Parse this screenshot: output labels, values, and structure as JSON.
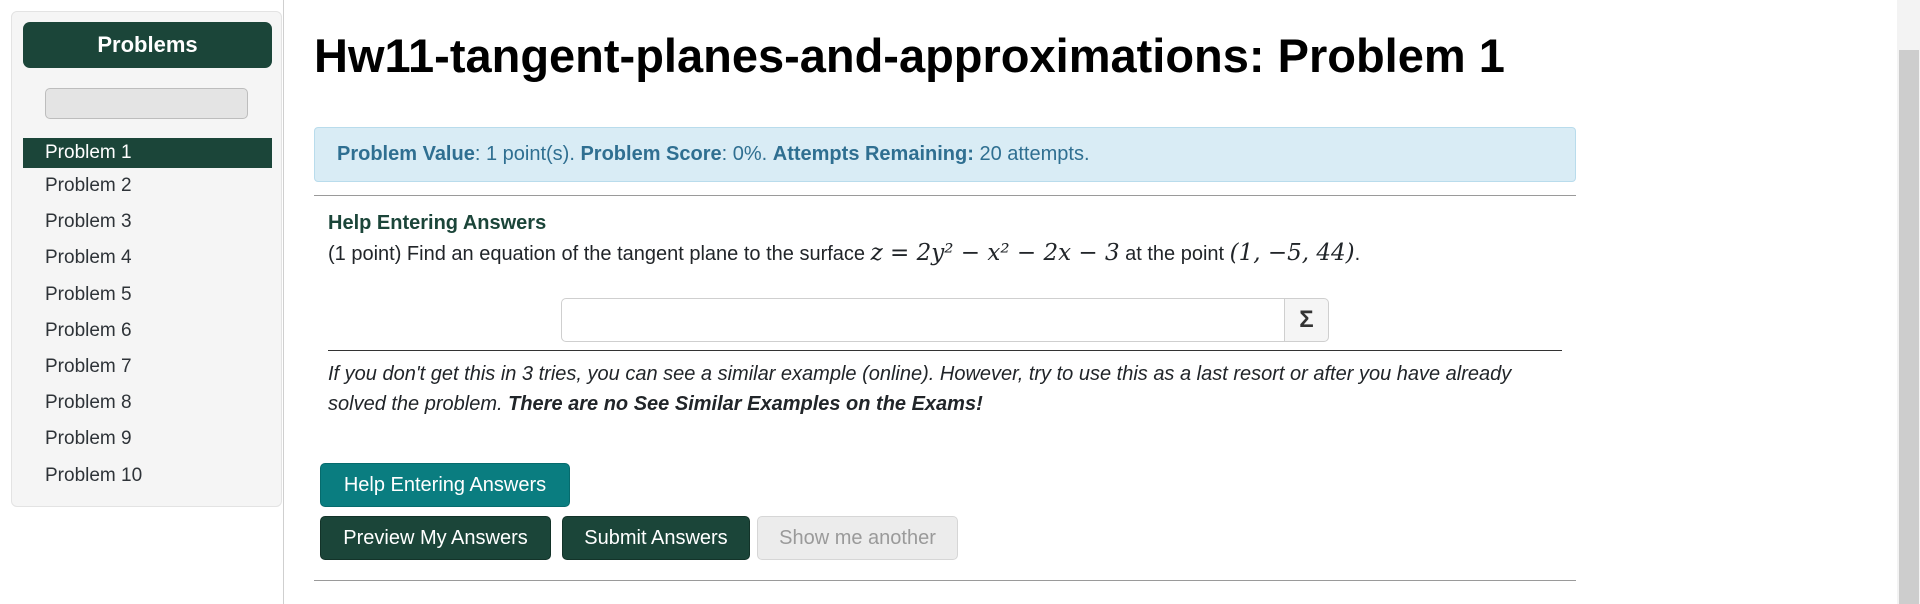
{
  "sidebar": {
    "title": "Problems",
    "items": [
      {
        "label": "Problem 1",
        "active": true
      },
      {
        "label": "Problem 2"
      },
      {
        "label": "Problem 3"
      },
      {
        "label": "Problem 4"
      },
      {
        "label": "Problem 5"
      },
      {
        "label": "Problem 6"
      },
      {
        "label": "Problem 7"
      },
      {
        "label": "Problem 8"
      },
      {
        "label": "Problem 9"
      },
      {
        "label": "Problem 10"
      }
    ]
  },
  "main": {
    "title": "Hw11-tangent-planes-and-approximations: Problem 1",
    "info": {
      "value_label": "Problem Value",
      "value_text": ": 1 point(s). ",
      "score_label": "Problem Score",
      "score_text": ": 0%. ",
      "attempts_label": "Attempts Remaining:",
      "attempts_text": " 20 attempts."
    },
    "help_heading": "Help Entering Answers",
    "problem": {
      "prefix": "(1 point) Find an equation of the tangent plane to the surface ",
      "equation": "z = 2y² − x² − 2x − 3",
      "middle": " at the point ",
      "point": "(1, −5, 44)",
      "suffix": "."
    },
    "answer_input_value": "",
    "sigma_label": "Σ",
    "hint": {
      "italic": "If you don't get this in 3 tries, you can see a similar example (online). However, try to use this as a last resort or after you have already solved the problem. ",
      "bold": "There are no See Similar Examples on the Exams!"
    },
    "buttons": {
      "help": "Help Entering Answers",
      "preview": "Preview My Answers",
      "submit": "Submit Answers",
      "another": "Show me another"
    }
  }
}
